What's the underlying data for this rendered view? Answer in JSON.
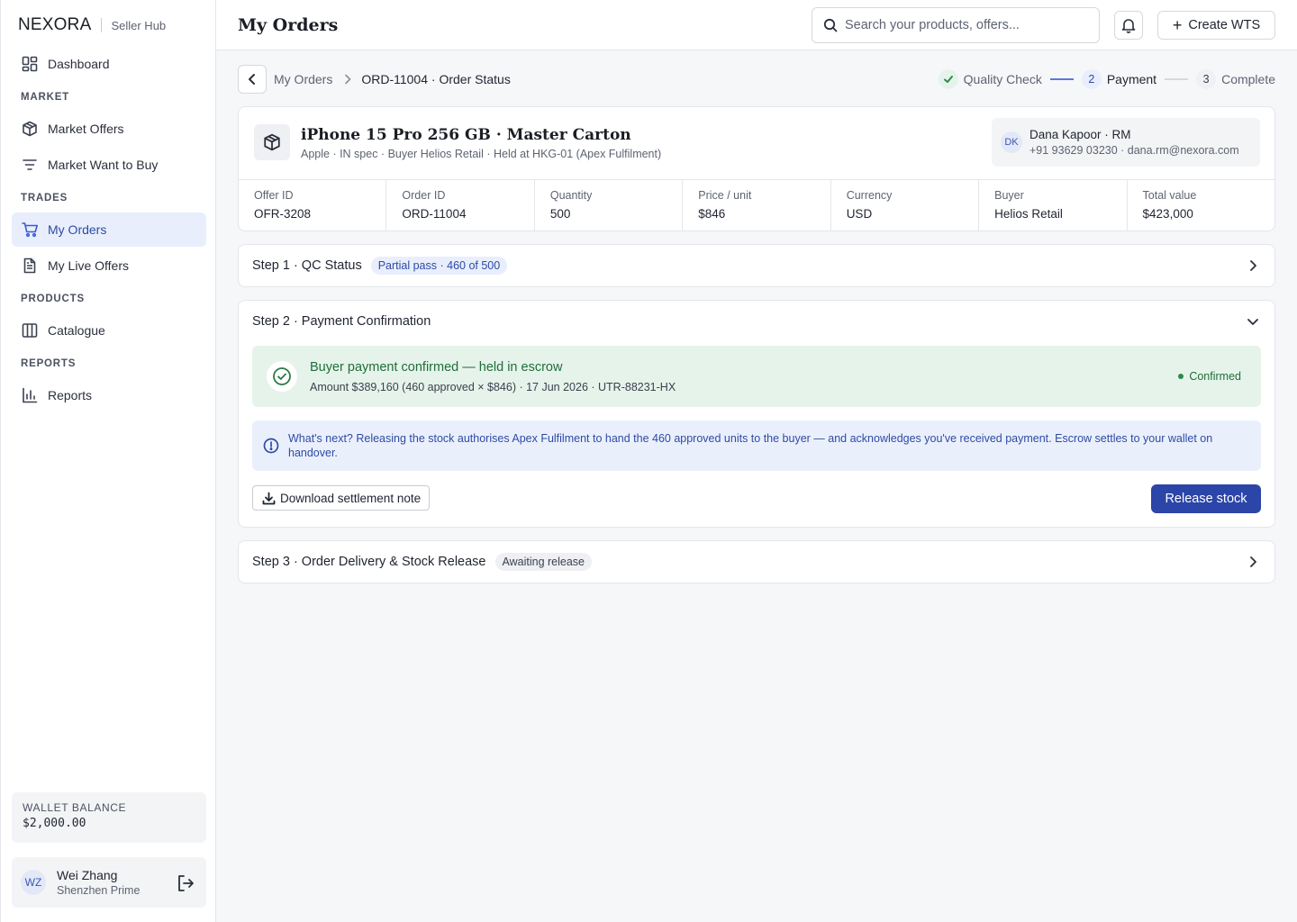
{
  "brand": {
    "logo": "NEXORA",
    "subtitle": "Seller Hub"
  },
  "sidebar": {
    "dashboard": "Dashboard",
    "sections": {
      "market": "MARKET",
      "trades": "TRADES",
      "products": "PRODUCTS",
      "reports": "REPORTS"
    },
    "items": {
      "market_offers": "Market Offers",
      "market_wtb": "Market Want to Buy",
      "my_orders": "My Orders",
      "my_live_offers": "My Live Offers",
      "catalogue": "Catalogue",
      "reports": "Reports"
    },
    "active": "my_orders",
    "wallet": {
      "label": "WALLET BALANCE",
      "value": "$2,000.00"
    },
    "user": {
      "initials": "WZ",
      "name": "Wei Zhang",
      "org": "Shenzhen Prime"
    }
  },
  "header": {
    "title": "My Orders",
    "search_placeholder": "Search your products, offers...",
    "create_label": "Create WTS"
  },
  "breadcrumb": {
    "parent": "My Orders",
    "current": "ORD-11004 · Order Status"
  },
  "stepper": [
    {
      "label": "Quality Check",
      "state": "done",
      "num": ""
    },
    {
      "label": "Payment",
      "state": "current",
      "num": "2"
    },
    {
      "label": "Complete",
      "state": "todo",
      "num": "3"
    }
  ],
  "product": {
    "title": "iPhone 15 Pro 256 GB · Master Carton",
    "subtitle": "Apple · IN spec · Buyer Helios Retail · Held at HKG-01 (Apex Fulfilment)",
    "rm": {
      "initials": "DK",
      "name": "Dana Kapoor · RM",
      "contact": "+91 93629 03230 · dana.rm@nexora.com"
    },
    "stats": [
      {
        "label": "Offer ID",
        "value": "OFR-3208"
      },
      {
        "label": "Order ID",
        "value": "ORD-11004"
      },
      {
        "label": "Quantity",
        "value": "500"
      },
      {
        "label": "Price / unit",
        "value": "$846"
      },
      {
        "label": "Currency",
        "value": "USD"
      },
      {
        "label": "Buyer",
        "value": "Helios Retail"
      },
      {
        "label": "Total value",
        "value": "$423,000"
      }
    ]
  },
  "step1": {
    "title": "Step 1 · QC Status",
    "pill": "Partial pass · 460 of 500"
  },
  "step2": {
    "title": "Step 2 · Payment Confirmation",
    "confirm_title": "Buyer payment confirmed — held in escrow",
    "confirm_sub": "Amount $389,160 (460 approved × $846) · 17 Jun 2026 · UTR-88231-HX",
    "confirm_status": "Confirmed",
    "info": "What's next? Releasing the stock authorises Apex Fulfilment to hand the 460 approved units to the buyer — and acknowledges you've received payment. Escrow settles to your wallet on handover.",
    "download_label": "Download settlement note",
    "release_label": "Release stock"
  },
  "step3": {
    "title": "Step 3 · Order Delivery & Stock Release",
    "pill": "Awaiting release"
  },
  "colors": {
    "accent": "#2b45a8",
    "success": "#2c8a4a",
    "success_bg": "#e6f3ea",
    "info_bg": "#eaf0fb"
  }
}
